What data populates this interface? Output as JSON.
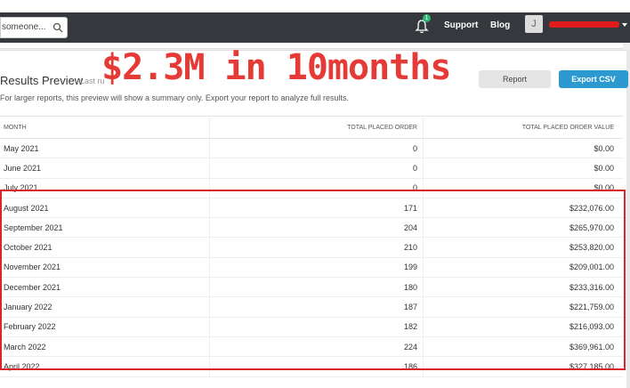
{
  "navbar": {
    "search_placeholder": "someone...",
    "notification_count": "1",
    "links": [
      "Support",
      "Blog"
    ],
    "avatar_initial": "J"
  },
  "results": {
    "title": "Results Preview",
    "last_run": "Last ru",
    "subtitle": "For larger reports, this preview will show a summary only. Export your report to analyze full results.",
    "report_button": "Report",
    "export_button": "Export CSV"
  },
  "overlay": {
    "text": "$2.3M in  10months",
    "color": "#e53a36"
  },
  "table": {
    "headers": [
      "MONTH",
      "TOTAL PLACED ORDER",
      "TOTAL PLACED ORDER VALUE"
    ],
    "rows": [
      [
        "May 2021",
        "0",
        "$0.00"
      ],
      [
        "June 2021",
        "0",
        "$0.00"
      ],
      [
        "July 2021",
        "0",
        "$0.00"
      ],
      [
        "August 2021",
        "171",
        "$232,076.00"
      ],
      [
        "September 2021",
        "204",
        "$265,970.00"
      ],
      [
        "October 2021",
        "210",
        "$253,820.00"
      ],
      [
        "November 2021",
        "199",
        "$209,001.00"
      ],
      [
        "December 2021",
        "180",
        "$233,316.00"
      ],
      [
        "January 2022",
        "187",
        "$221,759.00"
      ],
      [
        "February 2022",
        "182",
        "$216,093.00"
      ],
      [
        "March 2022",
        "224",
        "$369,961.00"
      ],
      [
        "April 2022",
        "186",
        "$327,185.00"
      ]
    ]
  }
}
